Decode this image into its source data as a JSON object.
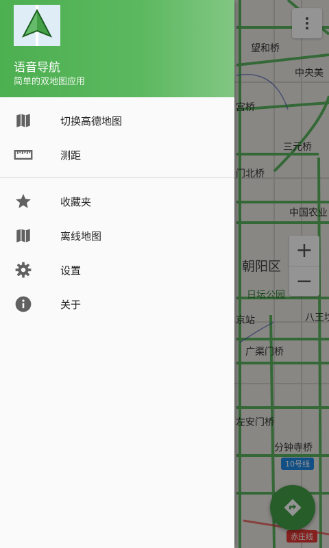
{
  "drawer": {
    "app_name": "语音导航",
    "app_subtitle": "简单的双地图应用",
    "primary_items": [
      {
        "label": "切换高德地图",
        "icon": "map-icon"
      },
      {
        "label": "测距",
        "icon": "ruler-icon"
      }
    ],
    "secondary_items": [
      {
        "label": "收藏夹",
        "icon": "star-icon"
      },
      {
        "label": "离线地图",
        "icon": "map-icon"
      },
      {
        "label": "设置",
        "icon": "gear-icon"
      },
      {
        "label": "关于",
        "icon": "info-icon"
      }
    ]
  },
  "map": {
    "labels": [
      "望和桥",
      "中央美",
      "宫桥",
      "三元桥",
      "门北桥",
      "中国农业",
      "朝阳区",
      "日坛公园",
      "京站",
      "八王坟",
      "广渠门桥",
      "左安门桥",
      "分钟寺桥",
      "10号线",
      "赤庄线"
    ],
    "zoom_in": "+",
    "zoom_out": "−"
  },
  "colors": {
    "accent": "#4caf50",
    "road_green": "#4caf50",
    "header_gradient_end": "#82c784"
  }
}
